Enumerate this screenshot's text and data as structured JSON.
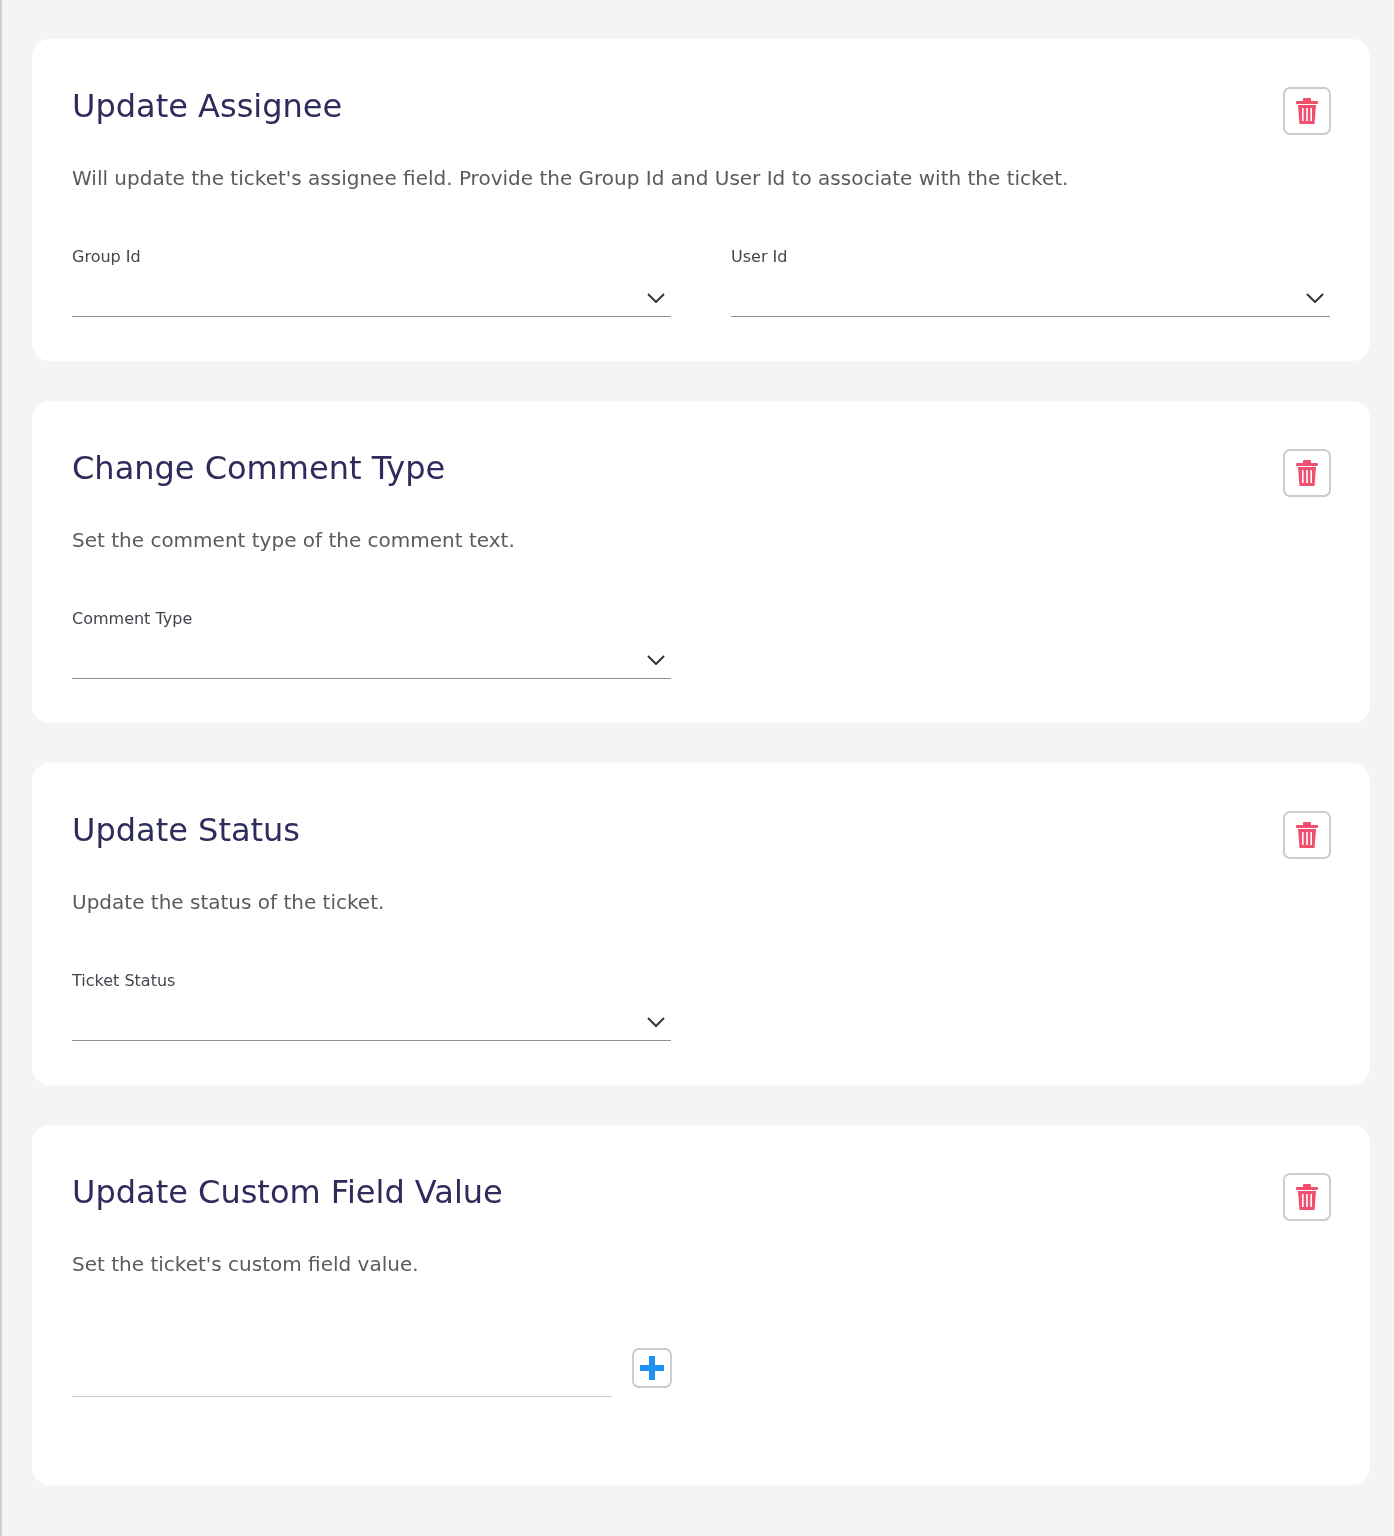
{
  "cards": [
    {
      "title": "Update Assignee",
      "description": "Will update the ticket's assignee field. Provide the Group Id and User Id to associate with the ticket.",
      "fields": [
        {
          "kind": "select",
          "label": "Group Id"
        },
        {
          "kind": "select",
          "label": "User Id"
        }
      ]
    },
    {
      "title": "Change Comment Type",
      "description": "Set the comment type of the comment text.",
      "fields": [
        {
          "kind": "select",
          "label": "Comment Type"
        }
      ]
    },
    {
      "title": "Update Status",
      "description": "Update the status of the ticket.",
      "fields": [
        {
          "kind": "select",
          "label": "Ticket Status"
        }
      ]
    },
    {
      "title": "Update Custom Field Value",
      "description": "Set the ticket's custom field value.",
      "fields": [
        {
          "kind": "text_add"
        }
      ]
    }
  ]
}
